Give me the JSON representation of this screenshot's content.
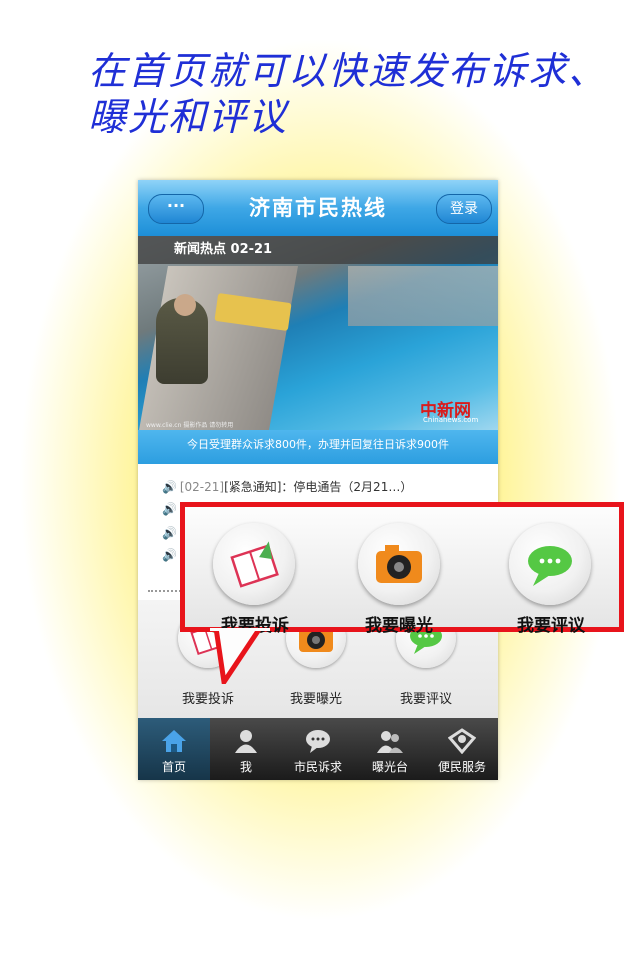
{
  "promo": {
    "line1": "在首页就可以快速发布诉求、",
    "line2": "曝光和评议"
  },
  "navbar": {
    "menu_label": "···",
    "title": "济南市民热线",
    "login_label": "登录"
  },
  "news": {
    "header": "新闻热点  02-21",
    "watermark": "中新网",
    "watermark_url": "Chinanews.com",
    "photo_credit": "www.clie.cn 摄影作品 请勿转用"
  },
  "stats_text": "今日受理群众诉求800件，办理并回复往日诉求900件",
  "notices": [
    {
      "date": "[02-21]",
      "text": "[紧急通知]：停电通告（2月21…）"
    }
  ],
  "quick_actions": [
    {
      "label": "我要投诉",
      "icon": "notebook-icon"
    },
    {
      "label": "我要曝光",
      "icon": "camera-icon"
    },
    {
      "label": "我要评议",
      "icon": "chat-bubble-icon"
    }
  ],
  "tabs": [
    {
      "label": "首页",
      "icon": "home-icon",
      "active": true
    },
    {
      "label": "我",
      "icon": "person-icon",
      "active": false
    },
    {
      "label": "市民诉求",
      "icon": "speech-icon",
      "active": false
    },
    {
      "label": "曝光台",
      "icon": "group-icon",
      "active": false
    },
    {
      "label": "便民服务",
      "icon": "service-icon",
      "active": false
    }
  ],
  "callout": {
    "labels": [
      "我要投诉",
      "我要曝光",
      "我要评议"
    ]
  },
  "colors": {
    "navbar": "#3ea7e6",
    "callout_border": "#e8141b",
    "promo_text": "#1f2fd6",
    "background": "#fff38f"
  }
}
